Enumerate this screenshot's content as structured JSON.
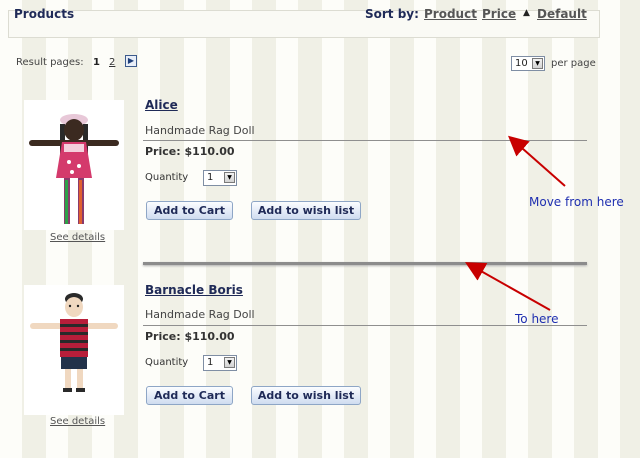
{
  "header": {
    "title": "Products",
    "sort_label": "Sort by:",
    "sort_options": [
      "Product",
      "Price",
      "Default"
    ],
    "active_sort_icon": "triangle-up-icon"
  },
  "pagination": {
    "label": "Result pages:",
    "pages": [
      "1",
      "2"
    ],
    "current_page": "1",
    "next_icon": "arrow-right-icon"
  },
  "per_page": {
    "value": "10",
    "label": "per page"
  },
  "products": [
    {
      "name": "Alice",
      "description": "Handmade Rag Doll",
      "price": "Price: $110.00",
      "quantity_label": "Quantity",
      "quantity_value": "1",
      "add_to_cart": "Add to Cart",
      "add_to_wishlist": "Add to wish list",
      "see_details": "See details"
    },
    {
      "name": "Barnacle Boris",
      "description": "Handmade Rag Doll",
      "price": "Price: $110.00",
      "quantity_label": "Quantity",
      "quantity_value": "1",
      "add_to_cart": "Add to Cart",
      "add_to_wishlist": "Add to wish list",
      "see_details": "See details"
    }
  ],
  "annotations": {
    "move_from": "Move from here",
    "to_here": "To here",
    "arrow_color": "#c80000",
    "text_color": "#1f2fb0"
  },
  "colors": {
    "heading": "#1f2a57",
    "button_border": "#8ea6c6"
  }
}
